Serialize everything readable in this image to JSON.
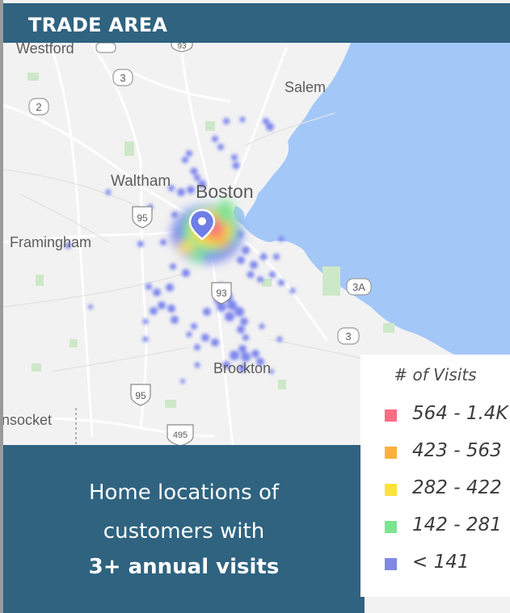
{
  "header": {
    "title": "TRADE AREA"
  },
  "map": {
    "place_labels": {
      "westford": "Westford",
      "salem": "Salem",
      "waltham": "Waltham",
      "boston": "Boston",
      "framingham": "Framingham",
      "brockton": "Brockton",
      "woonsocket": "nsocket"
    },
    "route_shields": {
      "r3_north": "3",
      "r2": "2",
      "r95_west": "95",
      "r93_south": "93",
      "r3a": "3A",
      "r3_south": "3",
      "r95_south": "95",
      "r495": "495",
      "r93_north": "93"
    },
    "marker_icon": "map-pin-icon"
  },
  "caption": {
    "line1": "Home locations of",
    "line2": "customers with",
    "line3": "3+ annual visits"
  },
  "legend": {
    "title": "# of Visits",
    "items": [
      {
        "label": "564 - 1.4K",
        "color": "#f76d82"
      },
      {
        "label": "423 - 563",
        "color": "#fbb03b"
      },
      {
        "label": "282 - 422",
        "color": "#fde23a"
      },
      {
        "label": "142 - 281",
        "color": "#7be48f"
      },
      {
        "label": "< 141",
        "color": "#8088e3"
      }
    ]
  },
  "colors": {
    "header_bg": "#2f6380",
    "land": "#f2f2f2",
    "water": "#a3c8f8",
    "heat_low": "#7d86ee",
    "heat_mid": "#7be48f",
    "heat_high": "#fde23a",
    "heat_higher": "#fbb03b",
    "heat_top": "#f76d82"
  }
}
